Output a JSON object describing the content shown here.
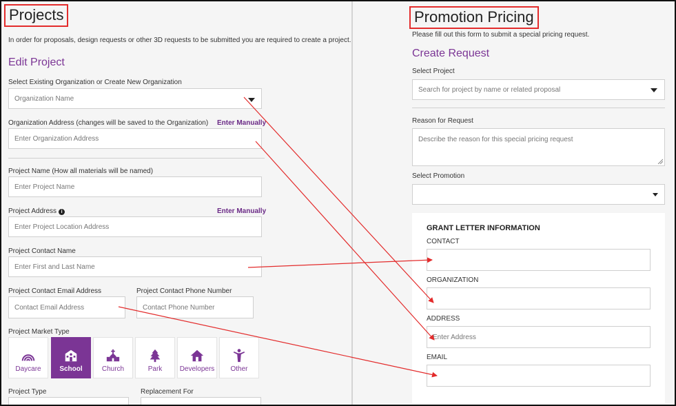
{
  "left": {
    "title": "Projects",
    "intro": "In order for proposals, design requests or other 3D requests to be submitted you are required to create a project.",
    "edit_heading": "Edit Project",
    "org_select_label": "Select Existing Organization or Create New Organization",
    "org_select_placeholder": "Organization Name",
    "org_address_label": "Organization Address (changes will be saved to the Organization)",
    "enter_manually": "Enter Manually",
    "org_address_placeholder": "Enter Organization Address",
    "project_name_label": "Project Name (How all materials will be named)",
    "project_name_placeholder": "Enter Project Name",
    "project_address_label": "Project Address",
    "info_glyph": "i",
    "project_address_placeholder": "Enter Project Location Address",
    "contact_name_label": "Project Contact Name",
    "contact_name_placeholder": "Enter First and Last Name",
    "contact_email_label": "Project Contact Email Address",
    "contact_email_placeholder": "Contact Email Address",
    "contact_phone_label": "Project Contact Phone Number",
    "contact_phone_placeholder": "Contact Phone Number",
    "market_type_label": "Project Market Type",
    "market_types": [
      {
        "label": "Daycare",
        "icon": "rainbow-icon",
        "selected": false
      },
      {
        "label": "School",
        "icon": "school-icon",
        "selected": true
      },
      {
        "label": "Church",
        "icon": "church-icon",
        "selected": false
      },
      {
        "label": "Park",
        "icon": "tree-icon",
        "selected": false
      },
      {
        "label": "Developers",
        "icon": "house-icon",
        "selected": false
      },
      {
        "label": "Other",
        "icon": "person-icon",
        "selected": false
      }
    ],
    "project_type_label": "Project Type",
    "replacement_for_label": "Replacement For"
  },
  "right": {
    "title": "Promotion Pricing",
    "intro": "Please fill out this form to submit a special pricing request.",
    "create_heading": "Create Request",
    "select_project_label": "Select Project",
    "select_project_placeholder": "Search for project by name or related proposal",
    "reason_label": "Reason for Request",
    "reason_placeholder": "Describe the reason for this special pricing request",
    "select_promotion_label": "Select Promotion",
    "select_promotion_value": "",
    "grant_heading": "GRANT LETTER INFORMATION",
    "contact_label": "CONTACT",
    "organization_label": "ORGANIZATION",
    "address_label": "ADDRESS",
    "address_placeholder": "Enter Address",
    "email_label": "EMAIL"
  },
  "colors": {
    "accent_purple": "#7b3595",
    "annotation_red": "#e32b2b",
    "panel_bg": "#f5f5f5"
  }
}
